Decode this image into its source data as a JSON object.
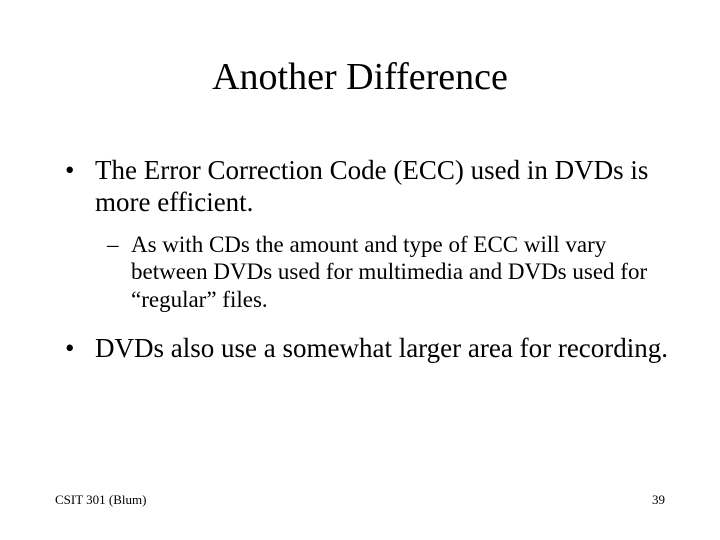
{
  "title": "Another Difference",
  "bullets": [
    {
      "level": 1,
      "marker": "•",
      "text": "The Error Correction Code (ECC) used in DVDs is more efficient."
    },
    {
      "level": 2,
      "marker": "–",
      "text": "As with CDs the amount and type of ECC will vary between DVDs used for multimedia and DVDs used for “regular” files."
    },
    {
      "level": 1,
      "marker": "•",
      "text": "DVDs also use a somewhat larger area for recording."
    }
  ],
  "footer": {
    "left": "CSIT 301 (Blum)",
    "right": "39"
  }
}
